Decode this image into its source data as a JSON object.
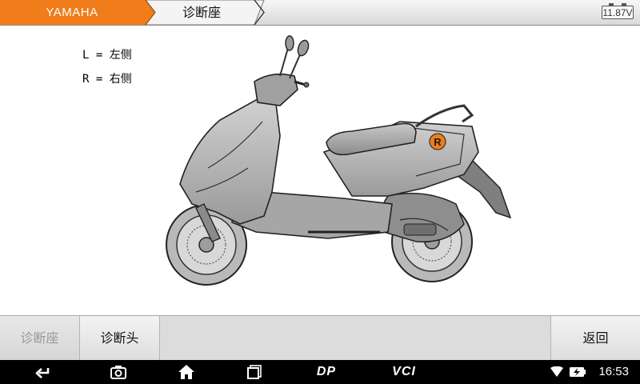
{
  "header": {
    "brand": "YAMAHA",
    "page_title": "诊断座",
    "battery_voltage": "11.87V",
    "brand_color": "#f07d1a"
  },
  "legend": {
    "left": "L = 左侧",
    "right": "R = 右侧"
  },
  "diagram": {
    "marker_label": "R",
    "marker_color": "#f07d1a",
    "marker_position": "right side, under rear seat"
  },
  "toolbar": {
    "btn_connector": "诊断座",
    "btn_head": "诊断头",
    "btn_back": "返回"
  },
  "navbar": {
    "dp_label": "DP",
    "vci_label": "VCI",
    "time": "16:53",
    "icons": [
      "back-icon",
      "camera-icon",
      "home-icon",
      "recent-apps-icon",
      "wifi-icon",
      "battery-charging-icon"
    ]
  }
}
